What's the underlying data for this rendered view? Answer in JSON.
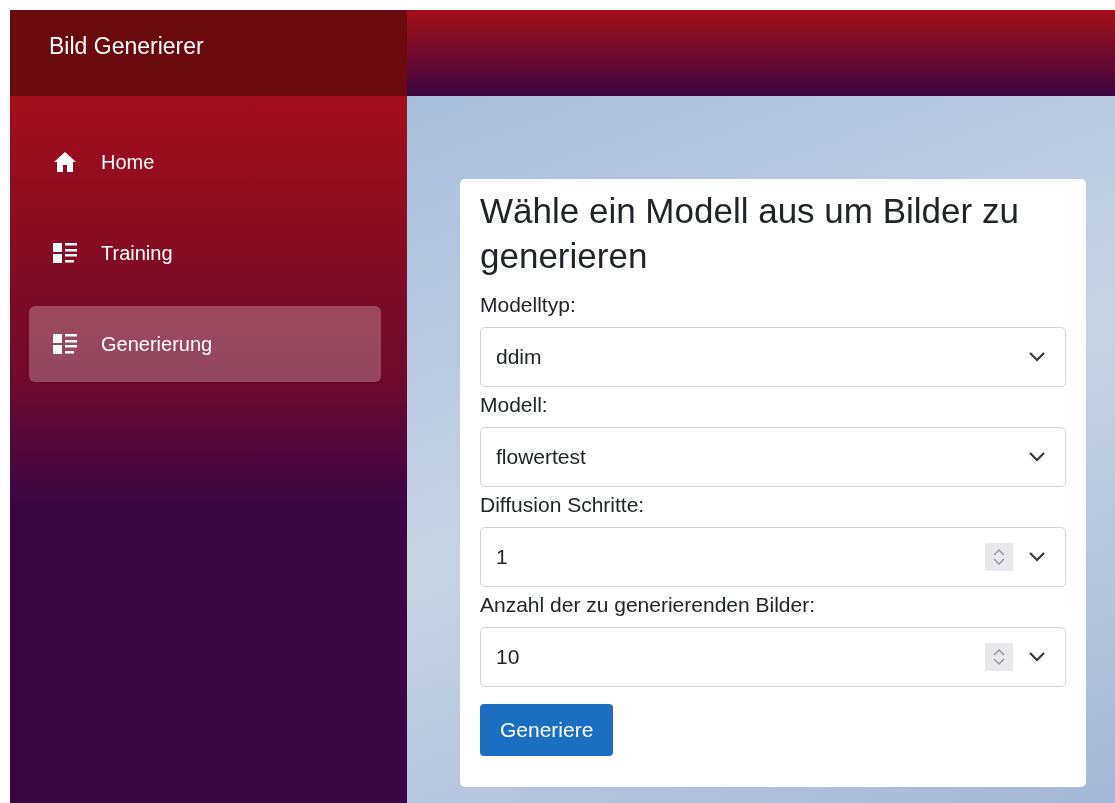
{
  "sidebar": {
    "title": "Bild Generierer",
    "items": [
      {
        "label": "Home",
        "kind": "home",
        "selected": false
      },
      {
        "label": "Training",
        "kind": "list",
        "selected": false
      },
      {
        "label": "Generierung",
        "kind": "list",
        "selected": true
      }
    ]
  },
  "form": {
    "title": "Wähle ein Modell aus um Bilder zu generieren",
    "fields": [
      {
        "label": "Modelltyp:",
        "kind": "select",
        "value": "ddim"
      },
      {
        "label": "Modell:",
        "kind": "select",
        "value": "flowertest"
      },
      {
        "label": "Diffusion Schritte:",
        "kind": "number",
        "value": "1"
      },
      {
        "label": "Anzahl der zu generierenden Bilder:",
        "kind": "number",
        "value": "10"
      }
    ],
    "button": "Generiere"
  }
}
